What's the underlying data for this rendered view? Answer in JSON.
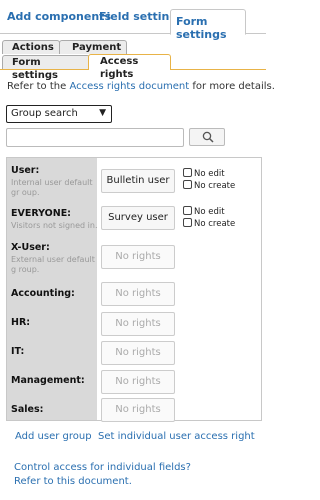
{
  "top_tabs": [
    "Add components",
    "Field settings",
    "Form settings"
  ],
  "sub_tabs": [
    "Actions",
    "Payment",
    "Form settings",
    "Access rights"
  ],
  "refer": {
    "prefix": "Refer to the",
    "link": "Access rights document",
    "suffix": "for more details."
  },
  "group_select": {
    "value": "Group search"
  },
  "search": {
    "placeholder": ""
  },
  "rows": [
    {
      "name": "User:",
      "desc": "Internal user default gr oup.",
      "rights": "Bulletin user",
      "has_rights": true,
      "no_edit": "No edit",
      "no_create": "No create"
    },
    {
      "name": "EVERYONE:",
      "desc": "Visitors not signed in.",
      "rights": "Survey user",
      "has_rights": true,
      "no_edit": "No edit",
      "no_create": "No create"
    },
    {
      "name": "X-User:",
      "desc": "External user default g roup.",
      "rights": "No rights",
      "has_rights": false
    },
    {
      "name": "Accounting:",
      "desc": "",
      "rights": "No rights",
      "has_rights": false
    },
    {
      "name": "HR:",
      "desc": "",
      "rights": "No rights",
      "has_rights": false
    },
    {
      "name": "IT:",
      "desc": "",
      "rights": "No rights",
      "has_rights": false
    },
    {
      "name": "Management:",
      "desc": "",
      "rights": "No rights",
      "has_rights": false
    },
    {
      "name": "Sales:",
      "desc": "",
      "rights": "No rights",
      "has_rights": false
    }
  ],
  "bottom": {
    "add_group": "Add user group",
    "set_individual": "Set individual user access right"
  },
  "footer": {
    "control_link": "Control access for individual fields?",
    "refer_link": "Refer to this document."
  },
  "colors": {
    "link": "#2a6fb0",
    "active_tab_border": "#e8b347",
    "left_panel": "#d9d9d9"
  }
}
